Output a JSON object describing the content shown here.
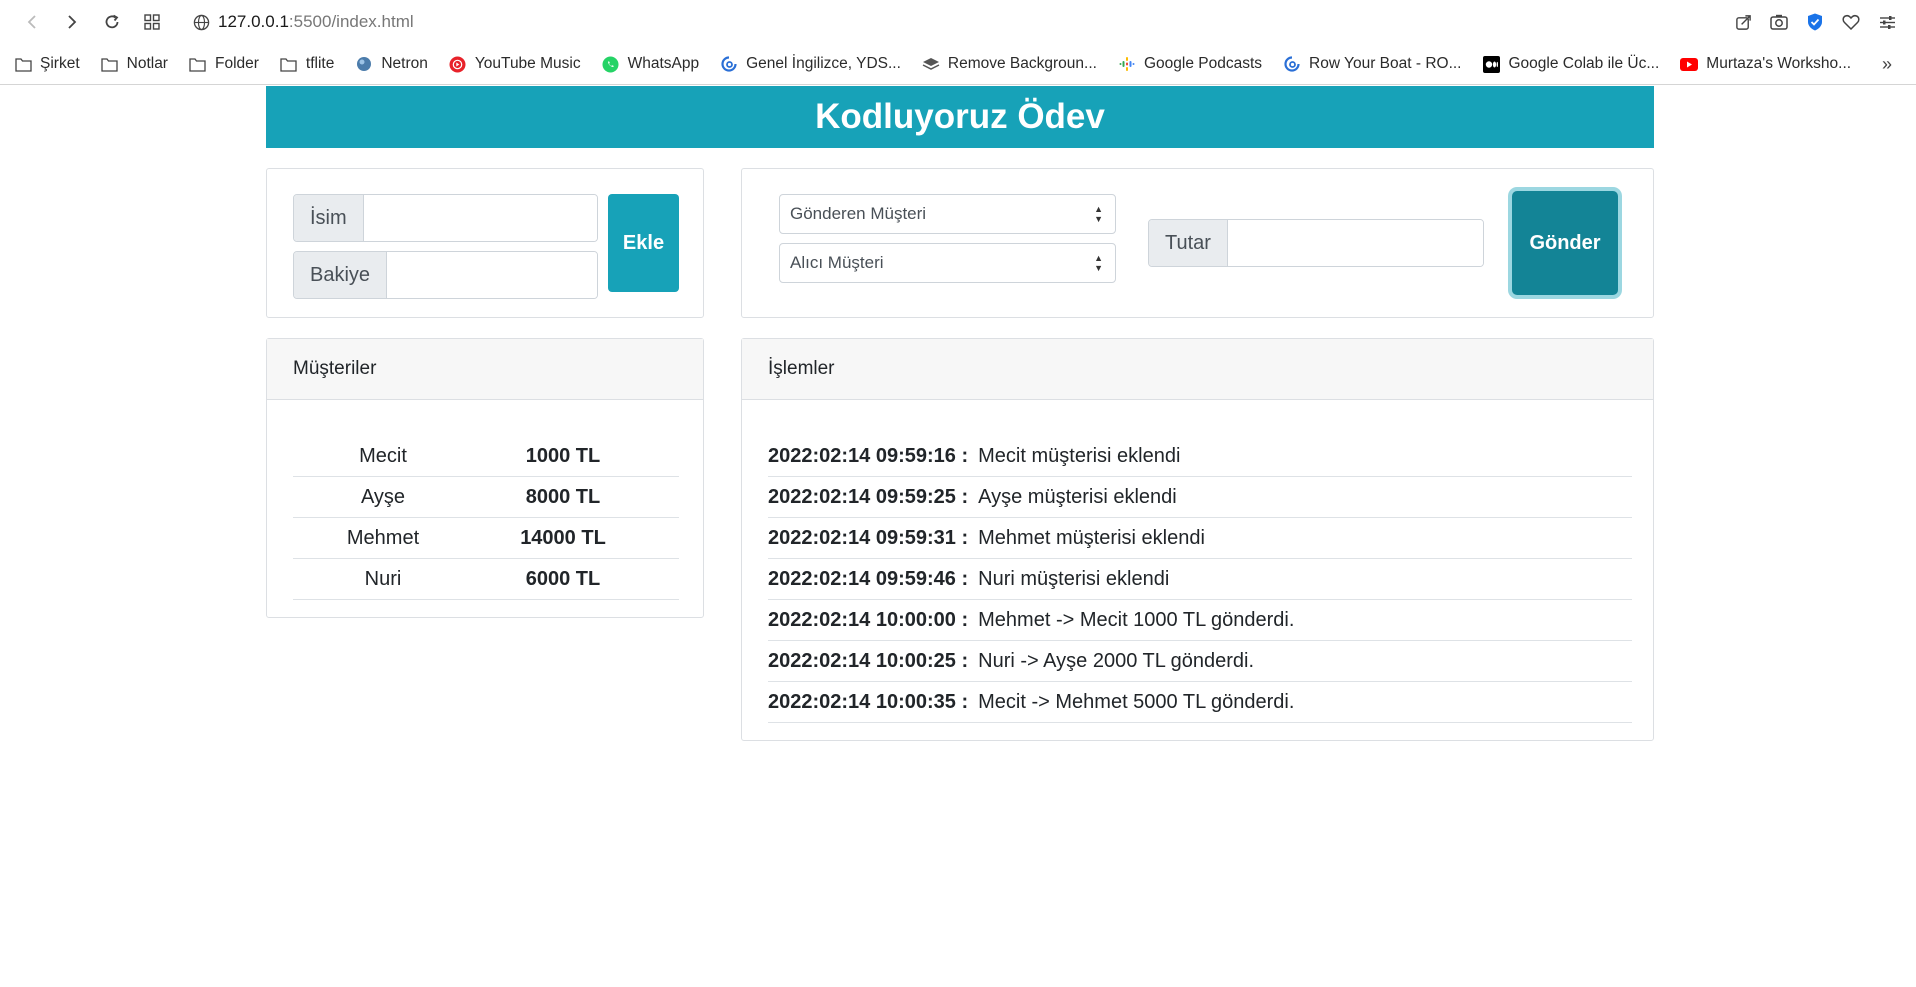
{
  "browser": {
    "url_host": "127.0.0.1",
    "url_path": ":5500/index.html",
    "bookmarks": [
      {
        "label": "Şirket",
        "icon": "folder-icon"
      },
      {
        "label": "Notlar",
        "icon": "folder-icon"
      },
      {
        "label": "Folder",
        "icon": "folder-icon"
      },
      {
        "label": "tflite",
        "icon": "folder-icon"
      },
      {
        "label": "Netron",
        "icon": "netron-icon"
      },
      {
        "label": "YouTube Music",
        "icon": "youtube-music-icon"
      },
      {
        "label": "WhatsApp",
        "icon": "whatsapp-icon"
      },
      {
        "label": "Genel İngilizce, YDS...",
        "icon": "site-icon"
      },
      {
        "label": "Remove Backgroun...",
        "icon": "layers-icon"
      },
      {
        "label": "Google Podcasts",
        "icon": "podcasts-icon"
      },
      {
        "label": "Row Your Boat - RO...",
        "icon": "site-icon"
      },
      {
        "label": "Google Colab ile Üc...",
        "icon": "medium-icon"
      },
      {
        "label": "Murtaza's Worksho...",
        "icon": "youtube-icon"
      }
    ]
  },
  "app": {
    "title": "Kodluyoruz Ödev"
  },
  "add_form": {
    "name_label": "İsim",
    "balance_label": "Bakiye",
    "add_button": "Ekle"
  },
  "transfer_form": {
    "sender_select": "Gönderen Müşteri",
    "receiver_select": "Alıcı Müşteri",
    "amount_label": "Tutar",
    "send_button": "Gönder"
  },
  "customers": {
    "header": "Müşteriler",
    "rows": [
      {
        "name": "Mecit",
        "balance": "1000 TL"
      },
      {
        "name": "Ayşe",
        "balance": "8000 TL"
      },
      {
        "name": "Mehmet",
        "balance": "14000 TL"
      },
      {
        "name": "Nuri",
        "balance": "6000 TL"
      }
    ]
  },
  "transactions": {
    "header": "İşlemler",
    "rows": [
      {
        "time": "2022:02:14 09:59:16 :",
        "text": "Mecit müşterisi eklendi"
      },
      {
        "time": "2022:02:14 09:59:25 :",
        "text": "Ayşe müşterisi eklendi"
      },
      {
        "time": "2022:02:14 09:59:31 :",
        "text": "Mehmet müşterisi eklendi"
      },
      {
        "time": "2022:02:14 09:59:46 :",
        "text": "Nuri müşterisi eklendi"
      },
      {
        "time": "2022:02:14 10:00:00 :",
        "text": "Mehmet -> Mecit 1000 TL gönderdi."
      },
      {
        "time": "2022:02:14 10:00:25 :",
        "text": "Nuri -> Ayşe 2000 TL gönderdi."
      },
      {
        "time": "2022:02:14 10:00:35 :",
        "text": "Mecit -> Mehmet 5000 TL gönderdi."
      }
    ]
  },
  "colors": {
    "primary": "#17a2b8",
    "primary_dark": "#138496"
  }
}
